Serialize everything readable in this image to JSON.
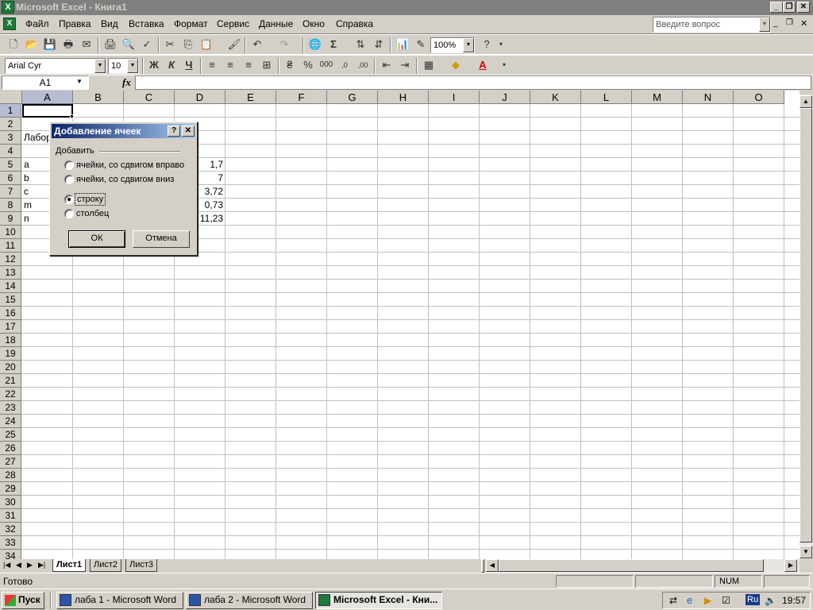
{
  "window": {
    "title": "Microsoft Excel - Книга1"
  },
  "menu": {
    "items": [
      "Файл",
      "Правка",
      "Вид",
      "Вставка",
      "Формат",
      "Сервис",
      "Данные",
      "Окно",
      "Справка"
    ],
    "help_placeholder": "Введите вопрос"
  },
  "toolbar": {
    "zoom": "100%",
    "font_name": "Arial Cyr",
    "font_size": "10"
  },
  "formula_bar": {
    "name_box": "A1",
    "fx_label": "fx",
    "content": ""
  },
  "grid": {
    "columns": [
      "A",
      "B",
      "C",
      "D",
      "E",
      "F",
      "G",
      "H",
      "I",
      "J",
      "K",
      "L",
      "M",
      "N",
      "O"
    ],
    "rows": [
      "1",
      "2",
      "3",
      "4",
      "5",
      "6",
      "7",
      "8",
      "9",
      "10",
      "11",
      "12",
      "13",
      "14",
      "15",
      "16",
      "17",
      "18",
      "19",
      "20",
      "21",
      "22",
      "23",
      "24",
      "25",
      "26",
      "27",
      "28",
      "29",
      "30",
      "31",
      "32",
      "33",
      "34"
    ],
    "cells": {
      "A3": "Лабор",
      "A5": "a",
      "D5": "1,7",
      "A6": "b",
      "D6": "7",
      "A7": "c",
      "D7": "3,72",
      "A8": "m",
      "D8": "0,73",
      "A9": "n",
      "D9": "11,23"
    }
  },
  "dialog": {
    "title": "Добавление ячеек",
    "group_label": "Добавить",
    "options": [
      "ячейки, со сдвигом вправо",
      "ячейки, со сдвигом вниз",
      "строку",
      "столбец"
    ],
    "selected": "строку",
    "ok_label": "ОК",
    "cancel_label": "Отмена"
  },
  "sheets": {
    "tabs": [
      "Лист1",
      "Лист2",
      "Лист3"
    ],
    "active": "Лист1"
  },
  "status": {
    "left": "Готово",
    "num": "NUM"
  },
  "taskbar": {
    "start": "Пуск",
    "tasks": [
      "лаба 1 - Microsoft Word",
      "лаба 2 - Microsoft Word",
      "Microsoft Excel - Кни..."
    ],
    "lang": "Ru",
    "clock": "19:57"
  }
}
